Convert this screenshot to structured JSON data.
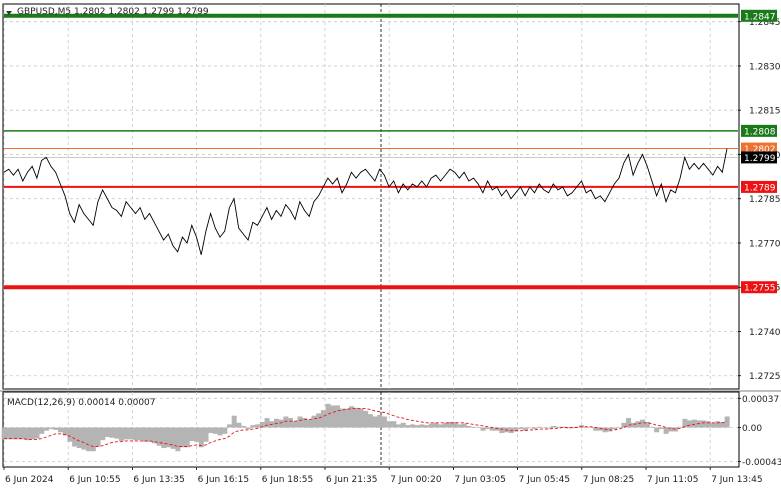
{
  "header": {
    "symbol_info": "GBPUSD,M5  1.2802 1.2802 1.2799 1.2799",
    "macd_label": "MACD(12,26,9) 0.00014 0.00007"
  },
  "price_axis": {
    "ticks": [
      "1.2845",
      "1.2830",
      "1.2815",
      "1.2800",
      "1.2785",
      "1.2770",
      "1.2755",
      "1.2740",
      "1.2725"
    ],
    "tick_values": [
      1.2845,
      1.283,
      1.2815,
      1.28,
      1.2785,
      1.277,
      1.2755,
      1.274,
      1.2725
    ]
  },
  "macd_axis": {
    "ticks": [
      "0.00037",
      "0.00",
      "-0.00043"
    ],
    "tick_values": [
      0.00037,
      0.0,
      -0.00043
    ]
  },
  "time_axis": {
    "ticks": [
      "6 Jun 2024",
      "6 Jun 10:55",
      "6 Jun 13:35",
      "6 Jun 16:15",
      "6 Jun 18:55",
      "6 Jun 21:35",
      "7 Jun 00:20",
      "7 Jun 03:05",
      "7 Jun 05:45",
      "7 Jun 08:25",
      "7 Jun 11:05",
      "7 Jun 13:45"
    ]
  },
  "level_lines": [
    {
      "name": "level-1-2847",
      "label": "1.2847",
      "value": 1.2847,
      "color": "#1a7a1a"
    },
    {
      "name": "level-1-2808",
      "label": "1.2808",
      "value": 1.2808,
      "color": "#1a7a1a"
    },
    {
      "name": "level-1-2802",
      "label": "1.2802",
      "value": 1.2802,
      "color": "#f07030"
    },
    {
      "name": "level-1-2799",
      "label": "1.2799",
      "value": 1.2799,
      "color": "#000000"
    },
    {
      "name": "level-1-2789",
      "label": "1.2789",
      "value": 1.2789,
      "color": "#ee1111"
    },
    {
      "name": "level-1-2755",
      "label": "1.2755",
      "value": 1.2755,
      "color": "#ee1111"
    }
  ],
  "chart_data": {
    "type": "line",
    "title": "GBPUSD,M5",
    "ylim": [
      1.27205,
      1.2851
    ],
    "macd_ylim": [
      -0.0005,
      0.00045
    ],
    "price_series": [
      1.2794,
      1.2795,
      1.2793,
      1.2795,
      1.2791,
      1.2794,
      1.2796,
      1.2792,
      1.2798,
      1.2799,
      1.2796,
      1.2794,
      1.279,
      1.2786,
      1.278,
      1.2777,
      1.2783,
      1.278,
      1.2778,
      1.2776,
      1.2784,
      1.2788,
      1.2785,
      1.2782,
      1.2781,
      1.2779,
      1.2784,
      1.2782,
      1.278,
      1.2782,
      1.2778,
      1.278,
      1.2777,
      1.2774,
      1.2771,
      1.2773,
      1.2769,
      1.2767,
      1.2772,
      1.277,
      1.2776,
      1.2772,
      1.2766,
      1.2774,
      1.278,
      1.2775,
      1.2772,
      1.2774,
      1.2782,
      1.2785,
      1.2775,
      1.2773,
      1.2771,
      1.2777,
      1.2776,
      1.2779,
      1.2782,
      1.2778,
      1.2781,
      1.2779,
      1.2783,
      1.2781,
      1.2778,
      1.2784,
      1.2781,
      1.2779,
      1.2784,
      1.2786,
      1.2789,
      1.2792,
      1.279,
      1.2792,
      1.2787,
      1.279,
      1.2794,
      1.2792,
      1.2794,
      1.2795,
      1.2793,
      1.2791,
      1.2795,
      1.2793,
      1.2789,
      1.2791,
      1.2787,
      1.279,
      1.2788,
      1.279,
      1.2789,
      1.2791,
      1.2789,
      1.2792,
      1.2793,
      1.2791,
      1.2793,
      1.2795,
      1.2794,
      1.2792,
      1.2794,
      1.2791,
      1.2792,
      1.279,
      1.2787,
      1.2791,
      1.2788,
      1.2789,
      1.2786,
      1.2788,
      1.2785,
      1.2787,
      1.2789,
      1.2786,
      1.2789,
      1.2787,
      1.279,
      1.2788,
      1.2787,
      1.279,
      1.2788,
      1.2789,
      1.2786,
      1.2787,
      1.2789,
      1.2791,
      1.2787,
      1.2788,
      1.2785,
      1.2786,
      1.2784,
      1.2787,
      1.279,
      1.2792,
      1.2797,
      1.28,
      1.2793,
      1.2797,
      1.28,
      1.2796,
      1.2791,
      1.2786,
      1.279,
      1.2784,
      1.2788,
      1.2787,
      1.2792,
      1.2799,
      1.2795,
      1.2797,
      1.2795,
      1.2797,
      1.2795,
      1.2793,
      1.2796,
      1.2794,
      1.2802
    ],
    "macd_histogram": [
      -0.00015,
      -0.00015,
      -0.00015,
      -0.00015,
      -0.00015,
      -0.00016,
      -0.00015,
      -0.00014,
      -8e-05,
      -4e-05,
      -2e-05,
      -3e-05,
      -6e-05,
      -0.0001,
      -0.00018,
      -0.00024,
      -0.00026,
      -0.00028,
      -0.0003,
      -0.0003,
      -0.00024,
      -0.00016,
      -0.00012,
      -0.00013,
      -0.00014,
      -0.00017,
      -0.00015,
      -0.00015,
      -0.00016,
      -0.00016,
      -0.00018,
      -0.00018,
      -0.0002,
      -0.00023,
      -0.00026,
      -0.00025,
      -0.00027,
      -0.0003,
      -0.00025,
      -0.00025,
      -0.00017,
      -0.00018,
      -0.00025,
      -0.00018,
      -7e-05,
      -8e-05,
      -0.0001,
      -8e-05,
      4e-05,
      0.00015,
      6e-05,
      2e-05,
      -2e-05,
      3e-05,
      4e-05,
      7e-05,
      0.00012,
      8e-05,
      0.00011,
      0.0001,
      0.00014,
      0.00012,
      8e-05,
      0.00014,
      0.00012,
      0.0001,
      0.00015,
      0.00018,
      0.00022,
      0.0003,
      0.00028,
      0.00028,
      0.00024,
      0.00024,
      0.00027,
      0.00025,
      0.00024,
      0.00021,
      0.00017,
      0.00014,
      0.00016,
      0.00014,
      8e-05,
      8e-05,
      4e-05,
      6e-05,
      3e-05,
      4e-05,
      3e-05,
      4e-05,
      3e-05,
      5e-05,
      6e-05,
      4e-05,
      6e-05,
      7e-05,
      7e-05,
      4e-05,
      5e-05,
      2e-05,
      1e-05,
      0.0,
      -4e-05,
      -2e-05,
      -4e-05,
      -4e-05,
      -7e-05,
      -6e-05,
      -7e-05,
      -5e-05,
      -2e-05,
      -4e-05,
      -1e-05,
      -2e-05,
      1e-05,
      0.0,
      -1e-05,
      2e-05,
      1e-05,
      1e-05,
      -1e-05,
      -1e-05,
      1e-05,
      3e-05,
      0.0,
      0.0,
      -4e-05,
      -4e-05,
      -6e-05,
      -5e-05,
      -2e-05,
      0.0,
      6e-05,
      0.00012,
      6e-05,
      8e-05,
      0.0001,
      7e-05,
      1e-05,
      -6e-05,
      -2e-05,
      -8e-05,
      -5e-05,
      -5e-05,
      1e-05,
      0.00011,
      9e-05,
      0.0001,
      9e-05,
      9e-05,
      8e-05,
      6e-05,
      8e-05,
      7e-05,
      0.00014
    ],
    "macd_signal": [
      -0.00014,
      -0.00014,
      -0.00014,
      -0.00014,
      -0.00014,
      -0.00015,
      -0.00015,
      -0.00015,
      -0.00014,
      -0.00012,
      -0.0001,
      -8e-05,
      -8e-05,
      -9e-05,
      -0.00011,
      -0.00014,
      -0.00017,
      -0.00019,
      -0.00022,
      -0.00024,
      -0.00024,
      -0.00023,
      -0.00021,
      -0.00019,
      -0.00018,
      -0.00018,
      -0.00017,
      -0.00017,
      -0.00017,
      -0.00017,
      -0.00017,
      -0.00017,
      -0.00018,
      -0.00019,
      -0.0002,
      -0.00021,
      -0.00022,
      -0.00024,
      -0.00024,
      -0.00024,
      -0.00023,
      -0.00022,
      -0.00023,
      -0.00022,
      -0.00019,
      -0.00017,
      -0.00015,
      -0.00014,
      -0.00011,
      -6e-05,
      -4e-05,
      -3e-05,
      -3e-05,
      -2e-05,
      -1e-05,
      1e-05,
      3e-05,
      4e-05,
      5e-05,
      6e-05,
      8e-05,
      8e-05,
      8e-05,
      9e-05,
      0.0001,
      0.0001,
      0.00011,
      0.00012,
      0.00014,
      0.00017,
      0.00019,
      0.00021,
      0.00022,
      0.00023,
      0.00024,
      0.00024,
      0.00024,
      0.00024,
      0.00023,
      0.00021,
      0.0002,
      0.00019,
      0.00017,
      0.00015,
      0.00013,
      0.00012,
      0.0001,
      9e-05,
      8e-05,
      7e-05,
      6e-05,
      6e-05,
      6e-05,
      6e-05,
      6e-05,
      6e-05,
      6e-05,
      6e-05,
      6e-05,
      5e-05,
      4e-05,
      3e-05,
      2e-05,
      1e-05,
      0.0,
      -1e-05,
      -2e-05,
      -3e-05,
      -4e-05,
      -4e-05,
      -4e-05,
      -4e-05,
      -3e-05,
      -3e-05,
      -2e-05,
      -2e-05,
      -2e-05,
      -1e-05,
      -1e-05,
      0.0,
      0.0,
      0.0,
      0.0,
      1e-05,
      1e-05,
      1e-05,
      0.0,
      -1e-05,
      -2e-05,
      -3e-05,
      -3e-05,
      -2e-05,
      0.0,
      3e-05,
      4e-05,
      5e-05,
      6e-05,
      6e-05,
      5e-05,
      3e-05,
      2e-05,
      0.0,
      -1e-05,
      -2e-05,
      -1e-05,
      1e-05,
      3e-05,
      4e-05,
      5e-05,
      6e-05,
      6e-05,
      6e-05,
      6e-05,
      6e-05,
      8e-05
    ]
  },
  "colors": {
    "price_line": "#000000",
    "grid": "#c8c8c8",
    "histogram": "#b4b4b4",
    "signal": "#ee1111",
    "crosshair": "#000000"
  }
}
